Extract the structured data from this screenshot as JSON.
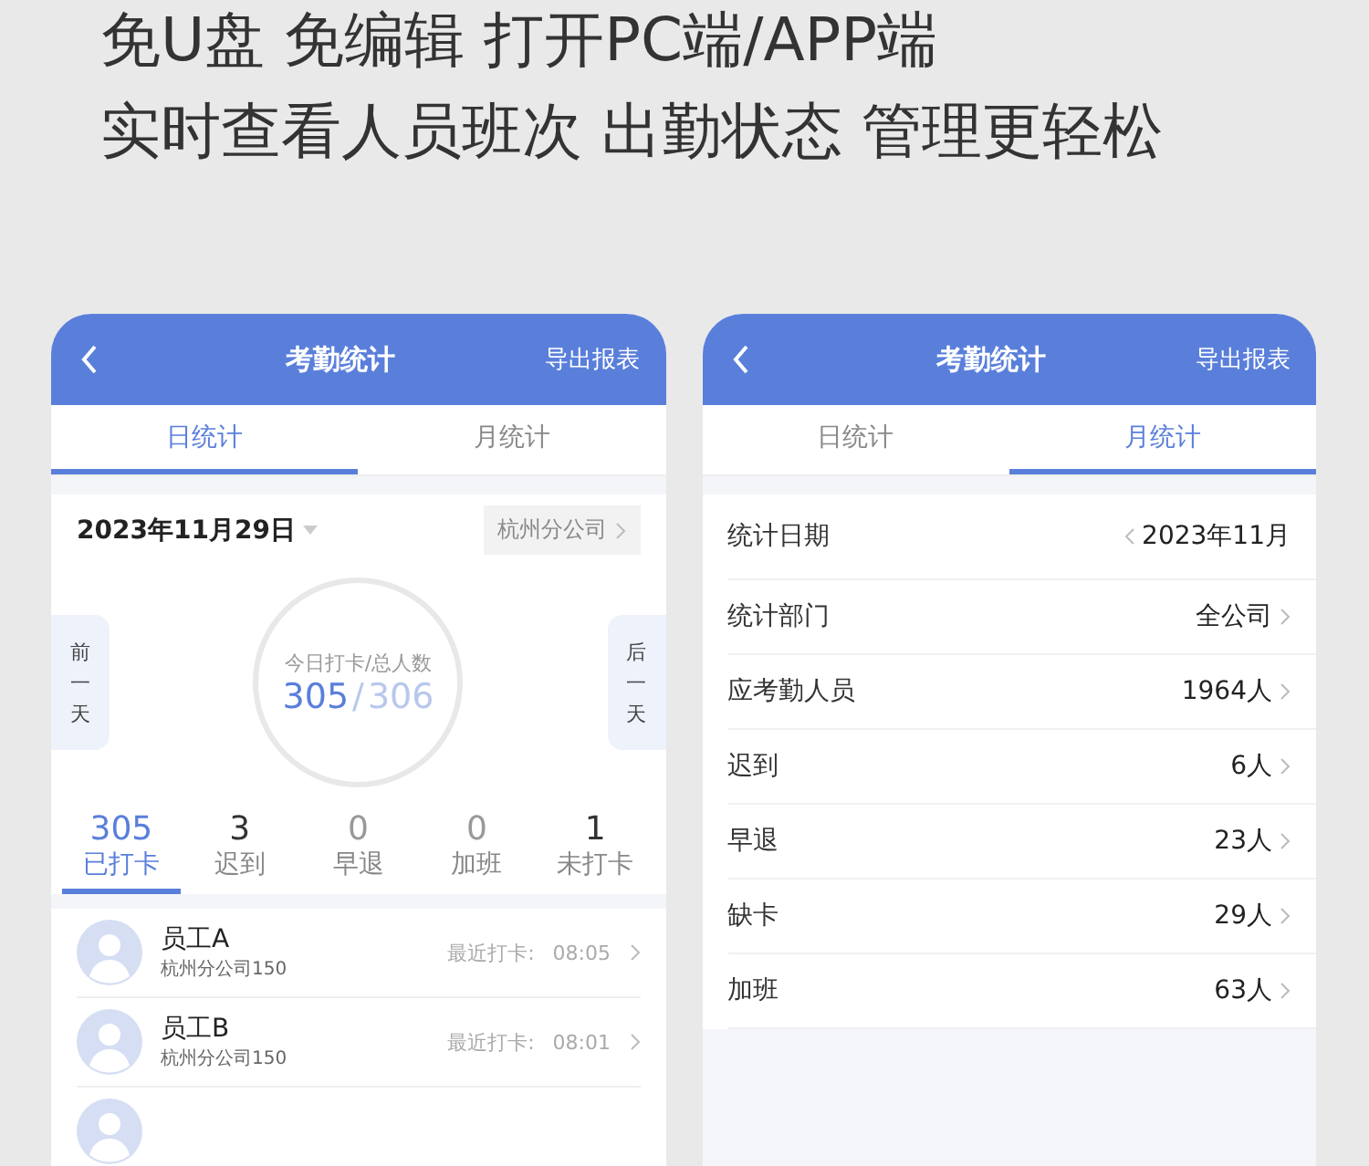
{
  "headline": [
    "免U盘 免编辑 打开PC端/APP端",
    "实时查看人员班次 出勤状态 管理更轻松"
  ],
  "phones": [
    {
      "kind": "daily",
      "title": "考勤统计",
      "action": "导出报表",
      "tabs": [
        {
          "label": "日统计",
          "selected": true
        },
        {
          "label": "月统计",
          "selected": false
        }
      ],
      "date": "2023年11月29日",
      "branch": "杭州分公司",
      "prev_day": "前一天",
      "next_day": "后一天",
      "ring": {
        "caption": "今日打卡/总人数",
        "done": "305",
        "sep": "/",
        "total": "306"
      },
      "stats": [
        {
          "value": "305",
          "label": "已打卡",
          "selected": true
        },
        {
          "value": "3",
          "label": "迟到",
          "selected": false
        },
        {
          "value": "0",
          "label": "早退",
          "selected": false
        },
        {
          "value": "0",
          "label": "加班",
          "selected": false
        },
        {
          "value": "1",
          "label": "未打卡",
          "selected": false
        }
      ],
      "employees": [
        {
          "name": "员工A",
          "dept": "杭州分公司150",
          "last_label": "最近打卡:",
          "time": "08:05"
        },
        {
          "name": "员工B",
          "dept": "杭州分公司150",
          "last_label": "最近打卡:",
          "time": "08:01"
        }
      ]
    },
    {
      "kind": "monthly",
      "title": "考勤统计",
      "action": "导出报表",
      "tabs": [
        {
          "label": "日统计",
          "selected": false
        },
        {
          "label": "月统计",
          "selected": true
        }
      ],
      "rows": [
        {
          "kind": "date",
          "label": "统计日期",
          "value": "2023年11月"
        },
        {
          "kind": "link",
          "label": "统计部门",
          "value": "全公司"
        },
        {
          "kind": "link",
          "label": "应考勤人员",
          "value": "1964人"
        },
        {
          "kind": "link",
          "label": "迟到",
          "value": "6人"
        },
        {
          "kind": "link",
          "label": "早退",
          "value": "23人"
        },
        {
          "kind": "link",
          "label": "缺卡",
          "value": "29人"
        },
        {
          "kind": "link",
          "label": "加班",
          "value": "63人"
        }
      ]
    }
  ]
}
